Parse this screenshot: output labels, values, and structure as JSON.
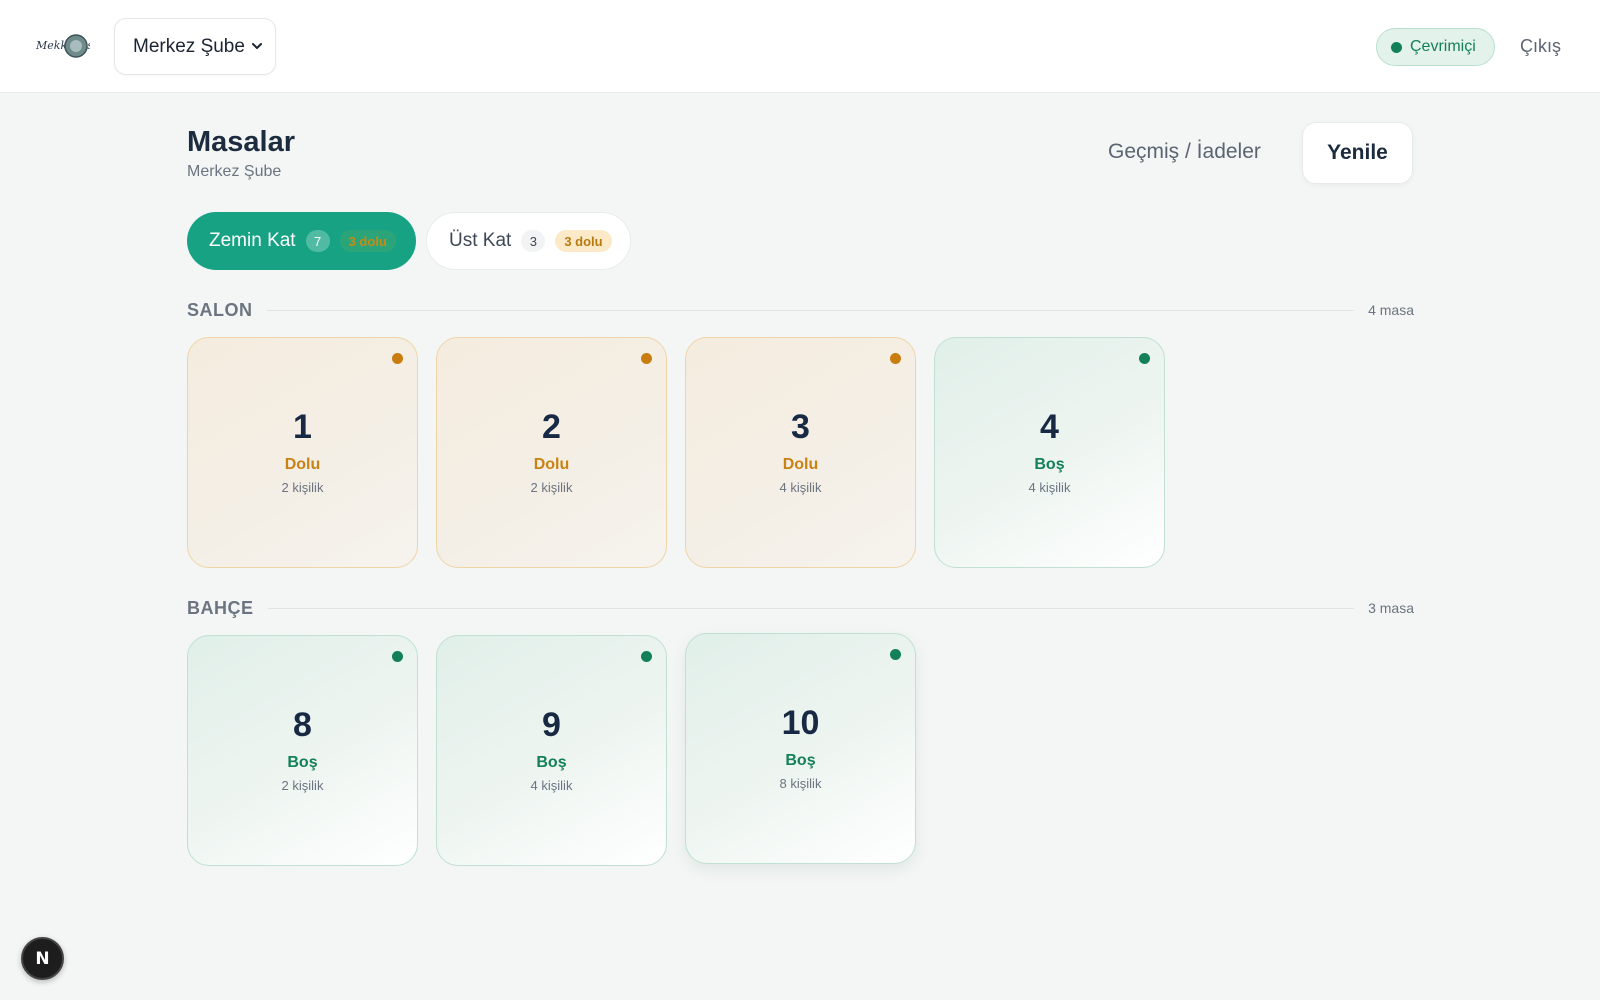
{
  "header": {
    "logo_text": "Mekkanos",
    "branch_select": {
      "value": "Merkez Şube"
    },
    "status": "Çevrimiçi",
    "logout": "Çıkış"
  },
  "page": {
    "title": "Masalar",
    "subtitle": "Merkez Şube",
    "history_link": "Geçmiş / İadeler",
    "refresh_button": "Yenile"
  },
  "floors": [
    {
      "label": "Zemin Kat",
      "count": "7",
      "busy": "3 dolu",
      "active": true
    },
    {
      "label": "Üst Kat",
      "count": "3",
      "busy": "3 dolu",
      "active": false
    }
  ],
  "sections": [
    {
      "name": "SALON",
      "count_label": "4 masa",
      "tables": [
        {
          "number": "1",
          "status": "Dolu",
          "capacity": "2 kişilik"
        },
        {
          "number": "2",
          "status": "Dolu",
          "capacity": "2 kişilik"
        },
        {
          "number": "3",
          "status": "Dolu",
          "capacity": "4 kişilik"
        },
        {
          "number": "4",
          "status": "Boş",
          "capacity": "4 kişilik"
        }
      ]
    },
    {
      "name": "BAHÇE",
      "count_label": "3 masa",
      "tables": [
        {
          "number": "8",
          "status": "Boş",
          "capacity": "2 kişilik"
        },
        {
          "number": "9",
          "status": "Boş",
          "capacity": "4 kişilik"
        },
        {
          "number": "10",
          "status": "Boş",
          "capacity": "8 kişilik"
        }
      ]
    }
  ],
  "floating_badge": "N",
  "colors": {
    "accent": "#17a383",
    "busy": "#c98214",
    "free": "#13805b"
  }
}
